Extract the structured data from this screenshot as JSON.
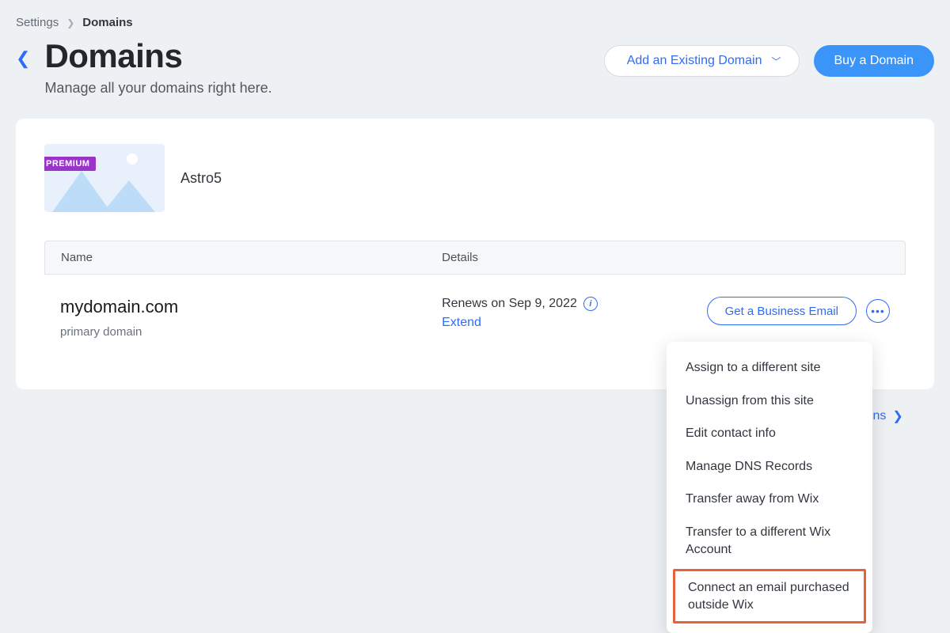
{
  "breadcrumb": {
    "parent": "Settings",
    "current": "Domains"
  },
  "header": {
    "title": "Domains",
    "subtitle": "Manage all your domains right here.",
    "add_existing": "Add an Existing Domain",
    "buy": "Buy a Domain"
  },
  "site": {
    "badge": "PREMIUM",
    "name": "Astro5"
  },
  "table": {
    "headers": {
      "name": "Name",
      "details": "Details"
    },
    "row": {
      "domain": "mydomain.com",
      "primary": "primary domain",
      "renews": "Renews on Sep 9, 2022",
      "extend": "Extend",
      "biz_email": "Get a Business Email"
    }
  },
  "menu": {
    "items": [
      "Assign to a different site",
      "Unassign from this site",
      "Edit contact info",
      "Manage DNS Records",
      "Transfer away from Wix",
      "Transfer to a different Wix Account",
      "Connect an email purchased outside Wix"
    ]
  },
  "peek": {
    "label": "ains"
  }
}
